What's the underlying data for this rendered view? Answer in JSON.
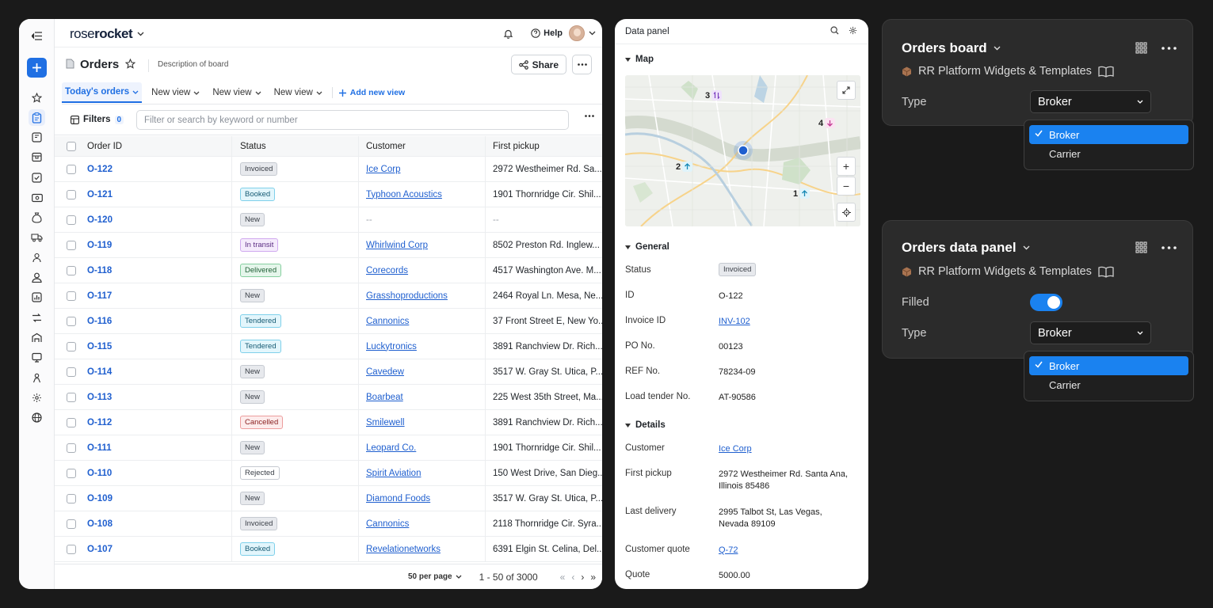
{
  "app": {
    "logo": {
      "part1": "rose",
      "part2": "rocket"
    },
    "help_label": "Help",
    "board_title": "Orders",
    "board_description": "Description of board",
    "share_label": "Share",
    "views": [
      {
        "label": "Today's orders",
        "active": true
      },
      {
        "label": "New view",
        "active": false
      },
      {
        "label": "New view",
        "active": false
      },
      {
        "label": "New view",
        "active": false
      }
    ],
    "add_view_label": "Add new view",
    "filters": {
      "label": "Filters",
      "count": "0",
      "search_placeholder": "Filter or search by keyword or number"
    },
    "table": {
      "columns": [
        "Order ID",
        "Status",
        "Customer",
        "First pickup"
      ],
      "rows": [
        {
          "id": "O-122",
          "status": "Invoiced",
          "tone": "gray",
          "customer": "Ice Corp",
          "pickup": "2972 Westheimer Rd. Sa..."
        },
        {
          "id": "O-121",
          "status": "Booked",
          "tone": "blue",
          "customer": "Typhoon Acoustics",
          "pickup": "1901 Thornridge Cir. Shil..."
        },
        {
          "id": "O-120",
          "status": "New",
          "tone": "gray",
          "customer": "--",
          "pickup": "--"
        },
        {
          "id": "O-119",
          "status": "In transit",
          "tone": "purple",
          "customer": "Whirlwind Corp",
          "pickup": "8502 Preston Rd. Inglew..."
        },
        {
          "id": "O-118",
          "status": "Delivered",
          "tone": "green",
          "customer": "Corecords",
          "pickup": "4517 Washington Ave. M..."
        },
        {
          "id": "O-117",
          "status": "New",
          "tone": "gray",
          "customer": "Grasshoproductions",
          "pickup": "2464 Royal Ln. Mesa, Ne..."
        },
        {
          "id": "O-116",
          "status": "Tendered",
          "tone": "blue",
          "customer": "Cannonics",
          "pickup": "37 Front Street E, New Yo..."
        },
        {
          "id": "O-115",
          "status": "Tendered",
          "tone": "blue",
          "customer": "Luckytronics",
          "pickup": "3891 Ranchview Dr. Rich..."
        },
        {
          "id": "O-114",
          "status": "New",
          "tone": "gray",
          "customer": "Cavedew",
          "pickup": "3517 W. Gray St. Utica, P..."
        },
        {
          "id": "O-113",
          "status": "New",
          "tone": "gray",
          "customer": "Boarbeat",
          "pickup": "225 West 35th Street, Ma..."
        },
        {
          "id": "O-112",
          "status": "Cancelled",
          "tone": "red",
          "customer": "Smilewell",
          "pickup": "3891 Ranchview Dr. Rich..."
        },
        {
          "id": "O-111",
          "status": "New",
          "tone": "gray",
          "customer": "Leopard Co.",
          "pickup": "1901 Thornridge Cir. Shil..."
        },
        {
          "id": "O-110",
          "status": "Rejected",
          "tone": "white",
          "customer": "Spirit Aviation",
          "pickup": "150 West Drive, San Dieg..."
        },
        {
          "id": "O-109",
          "status": "New",
          "tone": "gray",
          "customer": "Diamond Foods",
          "pickup": "3517 W. Gray St. Utica, P..."
        },
        {
          "id": "O-108",
          "status": "Invoiced",
          "tone": "gray",
          "customer": "Cannonics",
          "pickup": "2118 Thornridge Cir. Syra..."
        },
        {
          "id": "O-107",
          "status": "Booked",
          "tone": "blue",
          "customer": "Revelationetworks",
          "pickup": "6391 Elgin St. Celina, Del..."
        }
      ]
    },
    "pager": {
      "per_page": "50 per page",
      "range": "1 - 50 of 3000"
    }
  },
  "panel": {
    "title": "Data panel",
    "map_section": "Map",
    "map_pins": [
      "3",
      "4",
      "2",
      "1"
    ],
    "general_section": "General",
    "general": [
      {
        "label": "Status",
        "value": "Invoiced",
        "kind": "badge"
      },
      {
        "label": "ID",
        "value": "O-122",
        "kind": "text"
      },
      {
        "label": "Invoice ID",
        "value": "INV-102",
        "kind": "link"
      },
      {
        "label": "PO No.",
        "value": "00123",
        "kind": "text"
      },
      {
        "label": "REF No.",
        "value": "78234-09",
        "kind": "text"
      },
      {
        "label": "Load tender No.",
        "value": "AT-90586",
        "kind": "text"
      }
    ],
    "details_section": "Details",
    "details": [
      {
        "label": "Customer",
        "value": "Ice Corp",
        "kind": "link"
      },
      {
        "label": "First pickup",
        "value": "2972 Westheimer Rd. Santa Ana, Illinois 85486",
        "kind": "text"
      },
      {
        "label": "Last delivery",
        "value": "2995 Talbot St, Las Vegas, Nevada 89109",
        "kind": "text"
      },
      {
        "label": "Customer quote",
        "value": "Q-72",
        "kind": "link"
      },
      {
        "label": "Quote",
        "value": "5000.00",
        "kind": "text"
      }
    ]
  },
  "widgets": {
    "board": {
      "title": "Orders board",
      "subtitle": "RR Platform Widgets & Templates",
      "type_label": "Type",
      "type_value": "Broker",
      "options": [
        "Broker",
        "Carrier"
      ],
      "selected": "Broker"
    },
    "data_panel": {
      "title": "Orders data panel",
      "subtitle": "RR Platform Widgets & Templates",
      "filled_label": "Filled",
      "filled_on": true,
      "type_label": "Type",
      "type_value": "Broker",
      "options": [
        "Broker",
        "Carrier"
      ],
      "selected": "Broker"
    }
  },
  "colors": {
    "accent": "#1f6fe3",
    "dark_card": "#2b2b2b",
    "select_highlight": "#1a82f0"
  }
}
